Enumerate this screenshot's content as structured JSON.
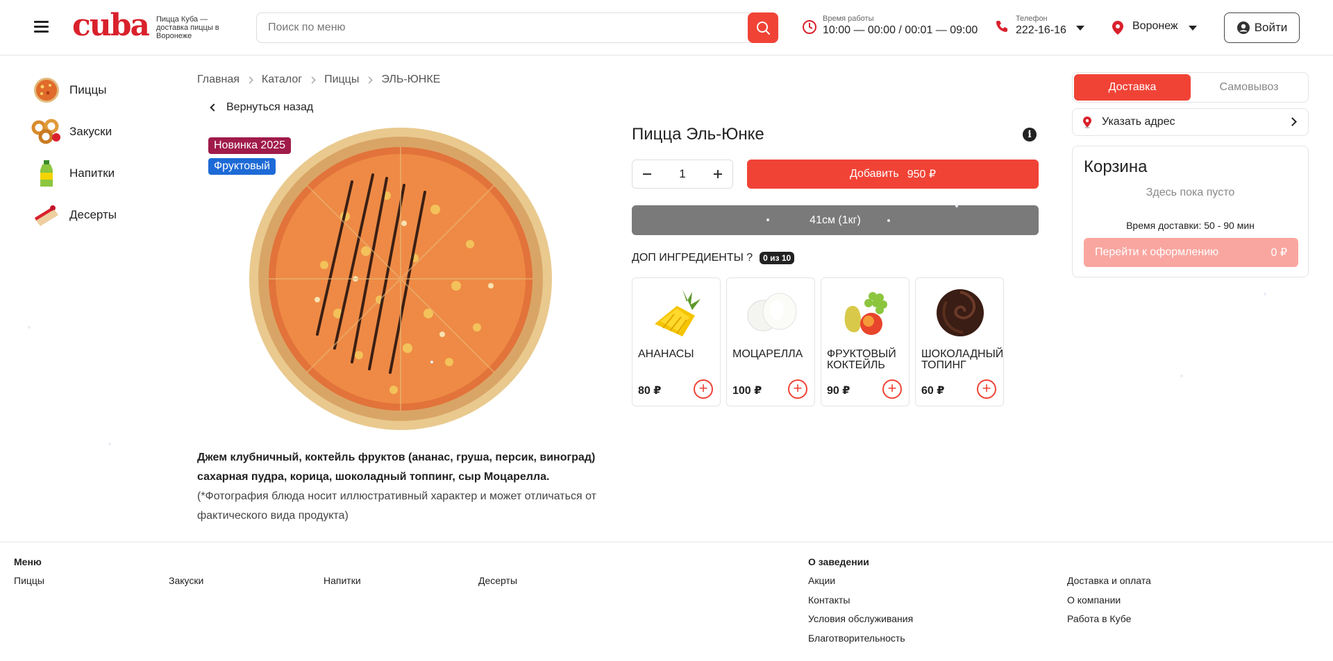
{
  "header": {
    "logo": "cuba",
    "tagline": "Пицца Куба — доставка пиццы в Воронеже",
    "search_placeholder": "Поиск по меню",
    "hours_label": "Время работы",
    "hours_value": "10:00 — 00:00 / 00:01 — 09:00",
    "phone_label": "Телефон",
    "phone_value": "222-16-16",
    "city": "Воронеж",
    "login": "Войти"
  },
  "sidebar": {
    "items": [
      {
        "label": "Пиццы",
        "icon": "pizza-icon"
      },
      {
        "label": "Закуски",
        "icon": "snacks-icon"
      },
      {
        "label": "Напитки",
        "icon": "drinks-icon"
      },
      {
        "label": "Десерты",
        "icon": "desserts-icon"
      }
    ]
  },
  "breadcrumb": [
    "Главная",
    "Каталог",
    "Пиццы",
    "ЭЛЬ-ЮНКЕ"
  ],
  "back_label": "Вернуться назад",
  "badges": [
    {
      "label": "Новинка 2025",
      "color": "#a01b4a"
    },
    {
      "label": "Фруктовый",
      "color": "#1d6ad6"
    }
  ],
  "product": {
    "title": "Пицца Эль-Юнке",
    "info_symbol": "i",
    "quantity": "1",
    "add_label": "Добавить",
    "add_price": "950 ₽",
    "size": "41см (1кг)",
    "extras_label": "ДОП ИНГРЕДИЕНТЫ ?",
    "extras_count": "0 из 10",
    "description_bold": "Джем клубничный, коктейль фруктов (ананас, груша, персик, виноград) сахарная пудра, корица, шоколадный топпинг, сыр Моцарелла.",
    "description_note": " (*Фотография блюда носит иллюстративный характер и может отличаться от фактического вида продукта)"
  },
  "extras": [
    {
      "name": "АНАНАСЫ",
      "price": "80 ₽",
      "icon": "pineapple-icon"
    },
    {
      "name": "МОЦАРЕЛЛА",
      "price": "100 ₽",
      "icon": "mozzarella-icon"
    },
    {
      "name": "ФРУКТОВЫЙ КОКТЕЙЛЬ",
      "price": "90 ₽",
      "icon": "fruit-cocktail-icon"
    },
    {
      "name": "ШОКОЛАДНЫЙ ТОПИНГ",
      "price": "60 ₽",
      "icon": "chocolate-icon"
    }
  ],
  "delivery": {
    "tab_delivery": "Доставка",
    "tab_pickup": "Самовывоз",
    "address": "Указать адрес"
  },
  "cart": {
    "title": "Корзина",
    "empty": "Здесь пока пусто",
    "delivery_time": "Время доставки: 50 - 90 мин",
    "checkout": "Перейти к оформлению",
    "total": "0 ₽"
  },
  "footer": {
    "menu_title": "Меню",
    "menu_links": [
      "Пиццы",
      "Закуски",
      "Напитки",
      "Десерты"
    ],
    "about_title": "О заведении",
    "about_links": [
      "Акции",
      "Контакты",
      "Условия обслуживания",
      "Благотворительность"
    ],
    "more_links": [
      "Доставка и оплата",
      "О компании",
      "Работа в Кубе"
    ]
  },
  "colors": {
    "accent": "#f04336",
    "brand": "#d9212c",
    "size_bar": "#7a7a7a"
  }
}
